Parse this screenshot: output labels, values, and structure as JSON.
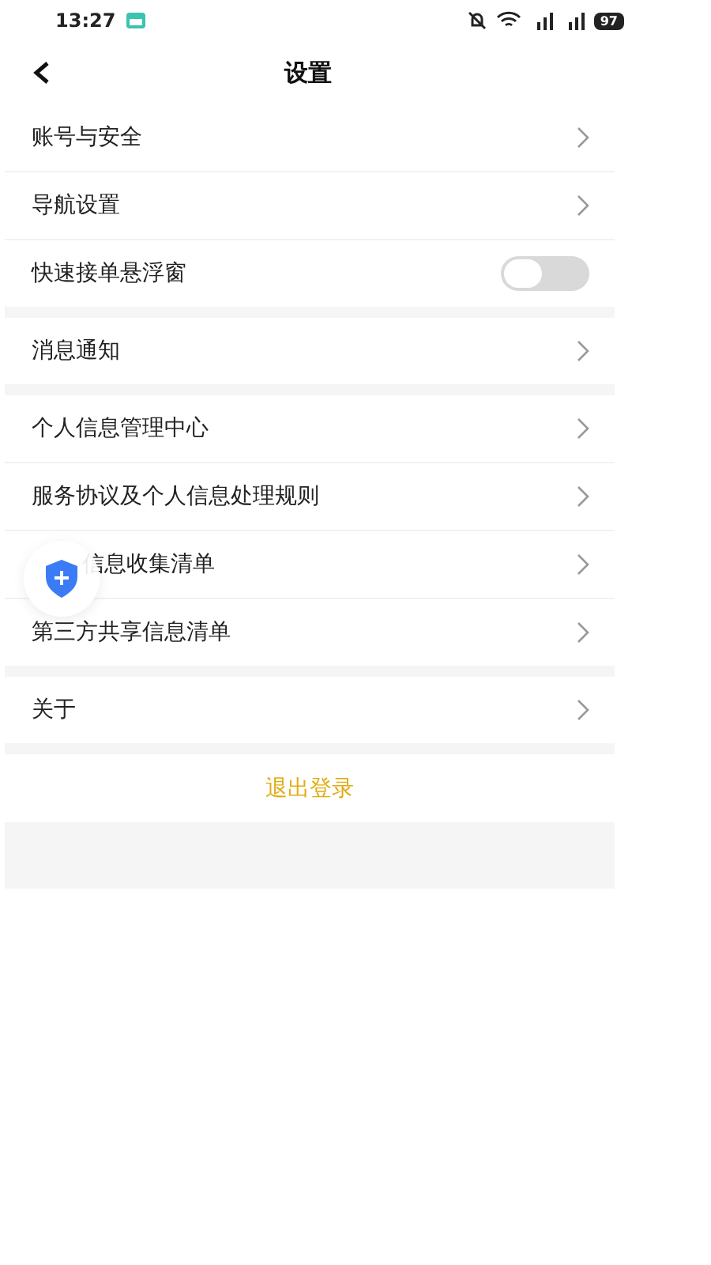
{
  "status_bar": {
    "time": "13:27",
    "battery": "97"
  },
  "header": {
    "title": "设置"
  },
  "sections": [
    {
      "items": [
        {
          "kind": "link",
          "label": "账号与安全"
        },
        {
          "kind": "link",
          "label": "导航设置"
        },
        {
          "kind": "toggle",
          "label": "快速接单悬浮窗",
          "on": false
        }
      ]
    },
    {
      "items": [
        {
          "kind": "link",
          "label": "消息通知"
        }
      ]
    },
    {
      "items": [
        {
          "kind": "link",
          "label": "个人信息管理中心"
        },
        {
          "kind": "link",
          "label": "服务协议及个人信息处理规则"
        },
        {
          "kind": "link",
          "label": "信息收集清单",
          "covered": true
        },
        {
          "kind": "link",
          "label": "第三方共享信息清单"
        }
      ]
    },
    {
      "items": [
        {
          "kind": "link",
          "label": "关于"
        }
      ]
    }
  ],
  "logout": {
    "label": "退出登录"
  }
}
